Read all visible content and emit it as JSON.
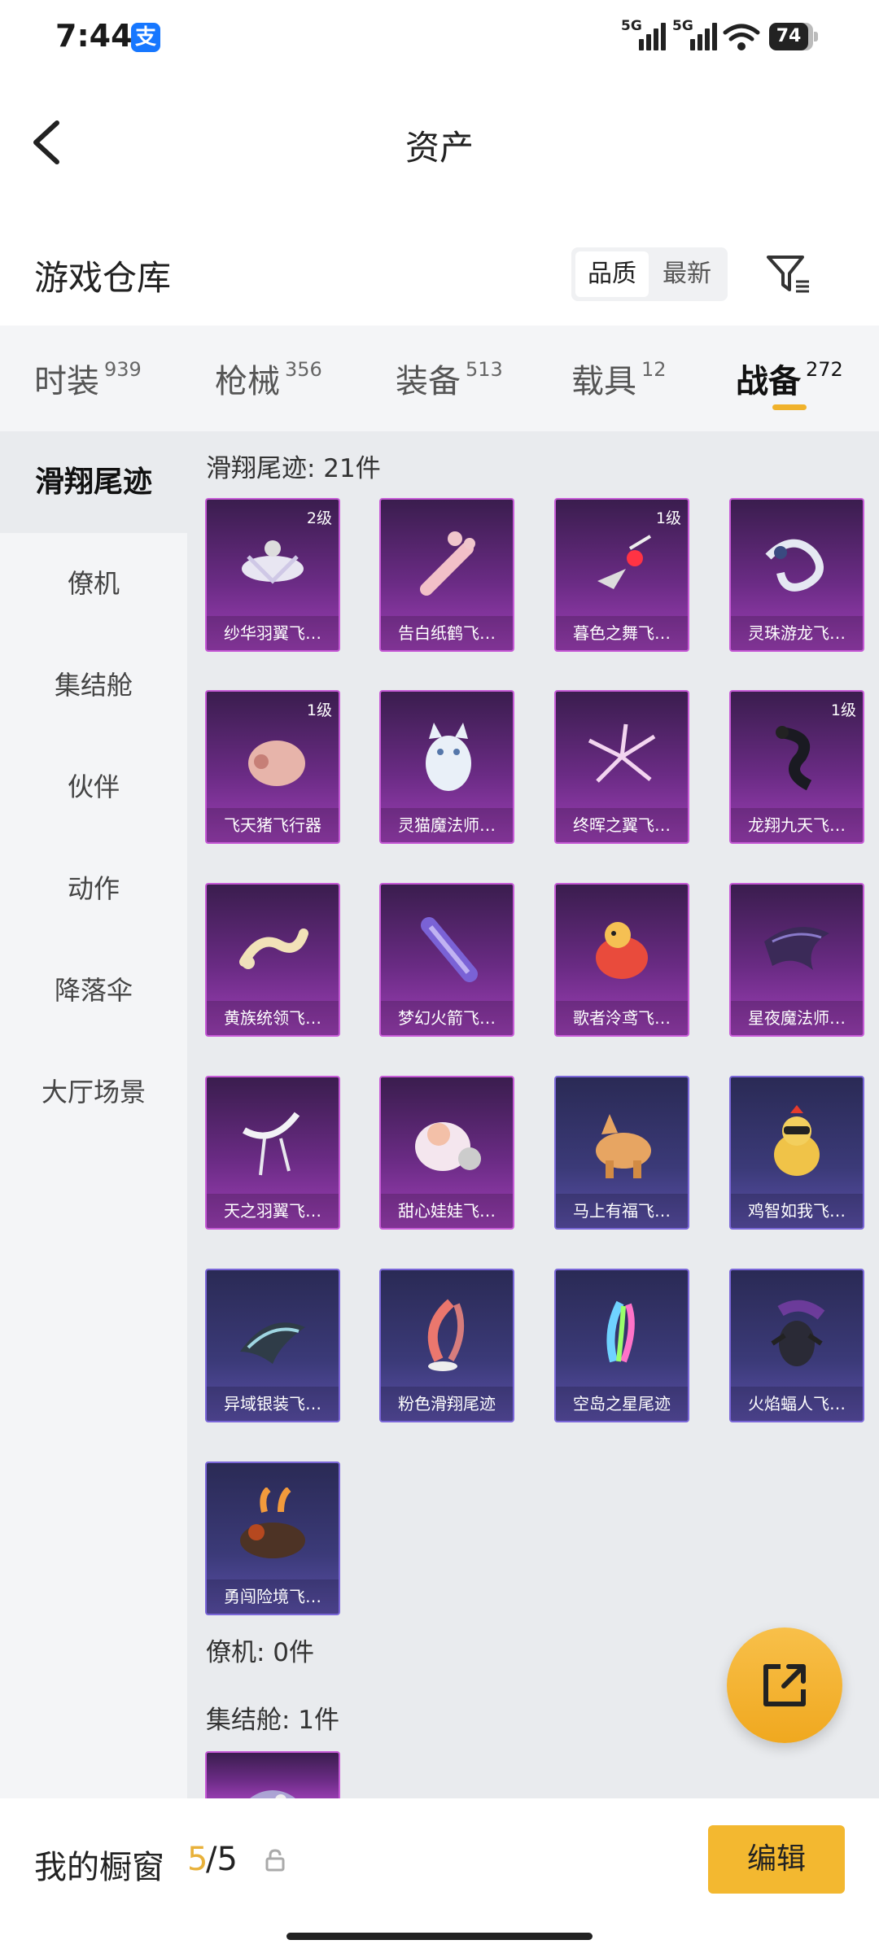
{
  "status": {
    "time": "7:44",
    "alipay_icon": "支",
    "sig1": "5G",
    "sig2": "5G",
    "battery": "74"
  },
  "header": {
    "title": "资产"
  },
  "section": {
    "title": "游戏仓库",
    "sort_options": [
      "品质",
      "最新"
    ],
    "active_sort": "品质"
  },
  "tabs": [
    {
      "label": "时装",
      "count": "939"
    },
    {
      "label": "枪械",
      "count": "356"
    },
    {
      "label": "装备",
      "count": "513"
    },
    {
      "label": "载具",
      "count": "12"
    },
    {
      "label": "战备",
      "count": "272"
    }
  ],
  "active_tab": "战备",
  "sidebar": {
    "items": [
      "滑翔尾迹",
      "僚机",
      "集结舱",
      "伙伴",
      "动作",
      "降落伞",
      "大厅场景"
    ],
    "active": "滑翔尾迹"
  },
  "groups": {
    "glide": {
      "label": "滑翔尾迹: 21件"
    },
    "wingman": {
      "label": "僚机: 0件"
    },
    "capsule": {
      "label": "集结舱: 1件"
    }
  },
  "items": [
    {
      "name": "纱华羽翼飞…",
      "level": "2级",
      "rarity": "purple"
    },
    {
      "name": "告白纸鹤飞…",
      "level": "",
      "rarity": "purple"
    },
    {
      "name": "暮色之舞飞…",
      "level": "1级",
      "rarity": "purple"
    },
    {
      "name": "灵珠游龙飞…",
      "level": "",
      "rarity": "purple"
    },
    {
      "name": "飞天猪飞行器",
      "level": "1级",
      "rarity": "purple"
    },
    {
      "name": "灵猫魔法师…",
      "level": "",
      "rarity": "purple"
    },
    {
      "name": "终晖之翼飞…",
      "level": "",
      "rarity": "purple"
    },
    {
      "name": "龙翔九天飞…",
      "level": "1级",
      "rarity": "purple"
    },
    {
      "name": "黄族统领飞…",
      "level": "",
      "rarity": "purple"
    },
    {
      "name": "梦幻火箭飞…",
      "level": "",
      "rarity": "purple"
    },
    {
      "name": "歌者泠鸢飞…",
      "level": "",
      "rarity": "purple"
    },
    {
      "name": "星夜魔法师…",
      "level": "",
      "rarity": "purple"
    },
    {
      "name": "天之羽翼飞…",
      "level": "",
      "rarity": "purple"
    },
    {
      "name": "甜心娃娃飞…",
      "level": "",
      "rarity": "purple"
    },
    {
      "name": "马上有福飞…",
      "level": "",
      "rarity": "blue"
    },
    {
      "name": "鸡智如我飞…",
      "level": "",
      "rarity": "blue"
    },
    {
      "name": "异域银装飞…",
      "level": "",
      "rarity": "blue"
    },
    {
      "name": "粉色滑翔尾迹",
      "level": "",
      "rarity": "blue"
    },
    {
      "name": "空岛之星尾迹",
      "level": "",
      "rarity": "blue"
    },
    {
      "name": "火焰蝠人飞…",
      "level": "",
      "rarity": "blue"
    },
    {
      "name": "勇闯险境飞…",
      "level": "",
      "rarity": "blue"
    }
  ],
  "showcase": {
    "label": "我的橱窗",
    "current": "5",
    "rest": "/5",
    "edit_label": "编辑"
  },
  "colors": {
    "accent": "#f0b22c",
    "purple_card": "#7a2f93",
    "blue_card": "#3b3a78"
  }
}
